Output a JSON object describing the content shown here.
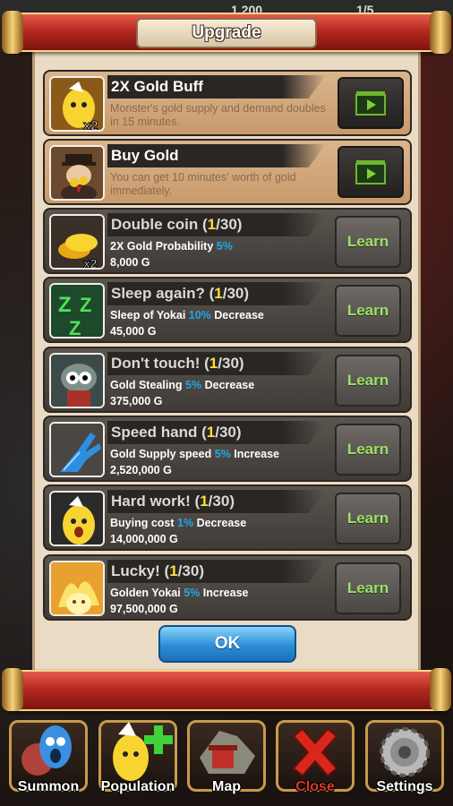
{
  "dialog": {
    "title": "Upgrade",
    "ok_label": "OK"
  },
  "specials": [
    {
      "name": "2X Gold Buff",
      "desc": "Monster's gold supply and demand doubles in 15 minutes.",
      "icon": "gold-buff-icon"
    },
    {
      "name": "Buy Gold",
      "desc": "You can get 10 minutes' worth of gold immediately.",
      "icon": "buy-gold-icon"
    }
  ],
  "skills": [
    {
      "name": "Double coin",
      "level": "1",
      "max": "30",
      "desc_pre": "2X Gold Probability ",
      "desc_hl": "5%",
      "desc_post": "",
      "cost": "8,000 G",
      "button": "Learn",
      "icon": "coins-icon"
    },
    {
      "name": "Sleep again?",
      "level": "1",
      "max": "30",
      "desc_pre": "Sleep of Yokai ",
      "desc_hl": "10%",
      "desc_post": " Decrease",
      "cost": "45,000 G",
      "button": "Learn",
      "icon": "zzz-icon"
    },
    {
      "name": "Don't touch!",
      "level": "1",
      "max": "30",
      "desc_pre": "Gold Stealing ",
      "desc_hl": "5%",
      "desc_post": " Decrease",
      "cost": "375,000 G",
      "button": "Learn",
      "icon": "thief-icon"
    },
    {
      "name": "Speed hand",
      "level": "1",
      "max": "30",
      "desc_pre": "Gold Supply speed ",
      "desc_hl": "5%",
      "desc_post": " Increase",
      "cost": "2,520,000 G",
      "button": "Learn",
      "icon": "hand-icon"
    },
    {
      "name": "Hard work!",
      "level": "1",
      "max": "30",
      "desc_pre": "Buying cost ",
      "desc_hl": "1%",
      "desc_post": " Decrease",
      "cost": "14,000,000 G",
      "button": "Learn",
      "icon": "yokai-icon"
    },
    {
      "name": "Lucky!",
      "level": "1",
      "max": "30",
      "desc_pre": "Golden Yokai ",
      "desc_hl": "5%",
      "desc_post": " Increase",
      "cost": "97,500,000 G",
      "button": "Learn",
      "icon": "golden-yokai-icon"
    }
  ],
  "nav": [
    {
      "label": "Summon",
      "icon": "summon-icon"
    },
    {
      "label": "Population",
      "icon": "population-icon"
    },
    {
      "label": "Map",
      "icon": "map-icon"
    },
    {
      "label": "Close",
      "icon": "close-icon"
    },
    {
      "label": "Settings",
      "icon": "settings-gear-icon"
    }
  ],
  "top_bar": {
    "left_value": "1,200",
    "right_value": "1/5"
  },
  "colors": {
    "learn_text": "#9de06a",
    "highlight": "#1fa8ea",
    "level": "#ffdf3a",
    "ok_button": "#2c8fd8"
  }
}
